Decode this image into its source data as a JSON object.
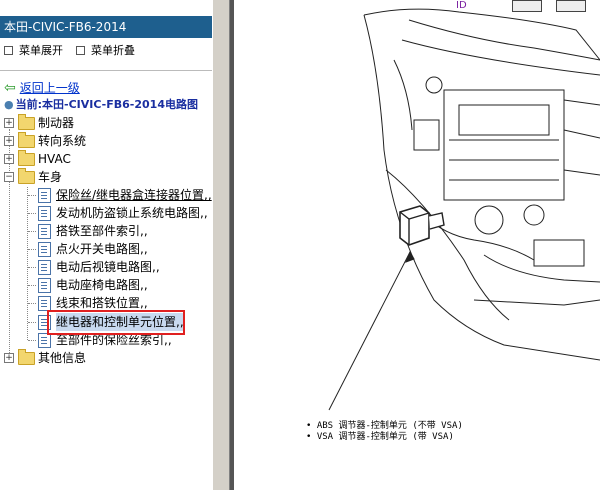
{
  "window": {
    "title": "本田-CIVIC-FB6-2014"
  },
  "toolbar": {
    "expand_label": "菜单展开",
    "collapse_label": "菜单折叠"
  },
  "nav": {
    "back_label": "返回上一级",
    "current_label": "当前:本田-CIVIC-FB6-2014电路图"
  },
  "tree": {
    "folders": [
      "制动器",
      "转向系统",
      "HVAC",
      "车身",
      "其他信息"
    ],
    "body_children": [
      "保险丝/继电器盒连接器位置,,",
      "发动机防盗锁止系统电路图,,",
      "搭铁至部件索引,,",
      "点火开关电路图,,",
      "电动后视镜电路图,,",
      "电动座椅电路图,,",
      "线束和搭铁位置,,",
      "继电器和控制单元位置,,",
      "至部件的保险丝索引,,"
    ],
    "selected_item": "继电器和控制单元位置,,"
  },
  "diagram": {
    "caption_lines": [
      "• ABS 调节器-控制单元 (不带 VSA)",
      "• VSA 调节器-控制单元 (带 VSA)"
    ],
    "logo_text": "ID"
  }
}
